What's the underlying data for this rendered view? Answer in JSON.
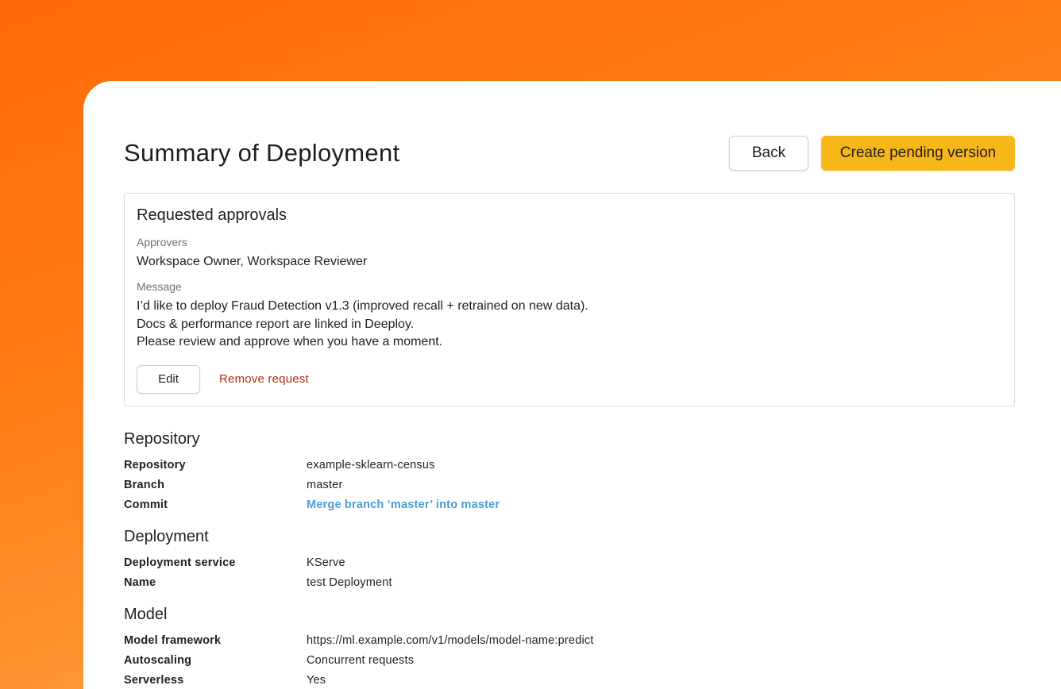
{
  "header": {
    "title": "Summary of Deployment",
    "back_label": "Back",
    "primary_label": "Create pending version"
  },
  "approvals": {
    "title": "Requested approvals",
    "approvers_label": "Approvers",
    "approvers_value": "Workspace Owner, Workspace Reviewer",
    "message_label": "Message",
    "message_lines": [
      "I’d like to deploy Fraud Detection v1.3 (improved recall + retrained on new data).",
      "Docs & performance report are linked in Deeploy.",
      "Please review and approve when you have a moment."
    ],
    "edit_label": "Edit",
    "remove_label": "Remove request"
  },
  "repository": {
    "title": "Repository",
    "rows": [
      {
        "key": "Repository",
        "value": "example-sklearn-census"
      },
      {
        "key": "Branch",
        "value": "master"
      },
      {
        "key": "Commit",
        "value": "Merge branch ‘master’ into master"
      }
    ]
  },
  "deployment": {
    "title": "Deployment",
    "rows": [
      {
        "key": "Deployment service",
        "value": "KServe"
      },
      {
        "key": "Name",
        "value": "test Deployment"
      }
    ]
  },
  "model": {
    "title": "Model",
    "rows": [
      {
        "key": "Model framework",
        "value": "https://ml.example.com/v1/models/model-name:predict"
      },
      {
        "key": "Autoscaling",
        "value": "Concurrent requests"
      },
      {
        "key": "Serverless",
        "value": "Yes"
      }
    ]
  },
  "colors": {
    "accent": "#f7b718",
    "link": "#4a9bd0",
    "danger": "#b32d0f",
    "background_gradient_start": "#ff6a08",
    "background_gradient_end": "#ffb24e"
  }
}
